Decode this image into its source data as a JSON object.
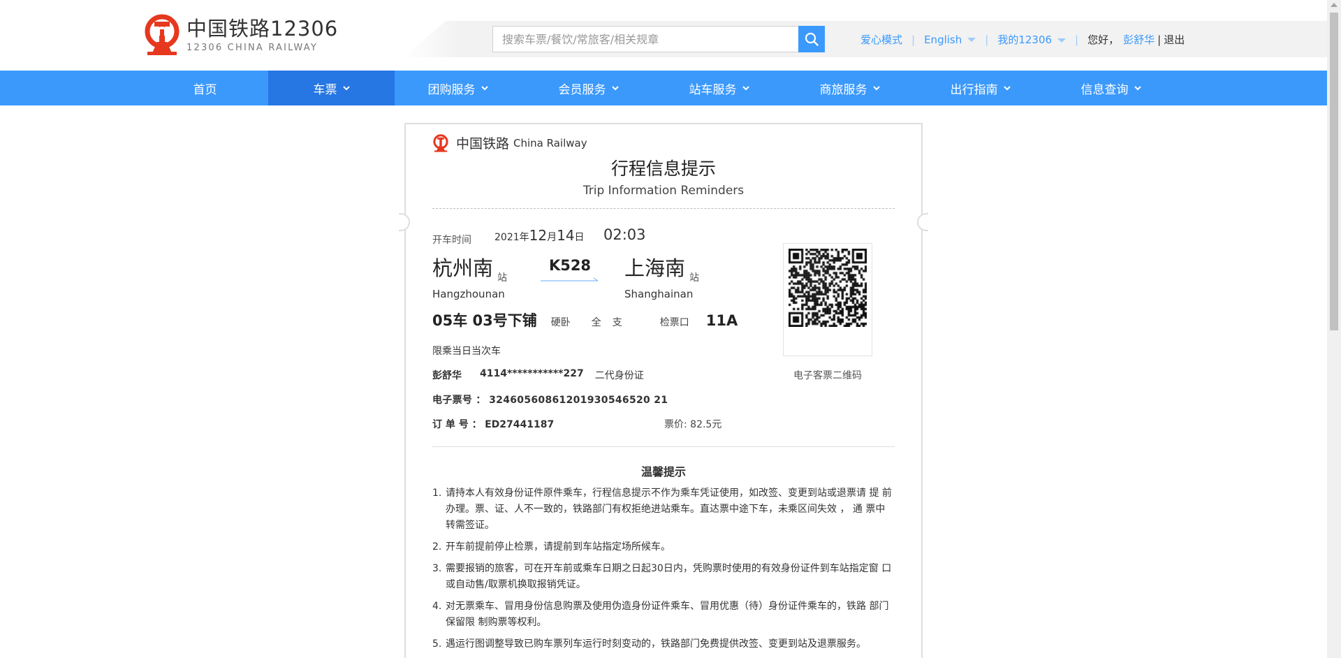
{
  "header": {
    "logo_cn": "中国铁路12306",
    "logo_en": "12306 CHINA RAILWAY",
    "search_placeholder": "搜索车票/餐饮/常旅客/相关规章",
    "links": {
      "care_mode": "爱心模式",
      "english": "English",
      "my12306": "我的12306",
      "greeting": "您好，",
      "username": "彭舒华",
      "logout": "退出"
    }
  },
  "nav": {
    "items": [
      {
        "label": "首页",
        "active": false,
        "dropdown": false
      },
      {
        "label": "车票",
        "active": true,
        "dropdown": true
      },
      {
        "label": "团购服务",
        "active": false,
        "dropdown": true
      },
      {
        "label": "会员服务",
        "active": false,
        "dropdown": true
      },
      {
        "label": "站车服务",
        "active": false,
        "dropdown": true
      },
      {
        "label": "商旅服务",
        "active": false,
        "dropdown": true
      },
      {
        "label": "出行指南",
        "active": false,
        "dropdown": true
      },
      {
        "label": "信息查询",
        "active": false,
        "dropdown": true
      }
    ]
  },
  "ticket": {
    "brand_cn": "中国铁路",
    "brand_en": "China Railway",
    "title": "行程信息提示",
    "subtitle": "Trip Information Reminders",
    "departure_label": "开车时间",
    "date": {
      "year": "2021",
      "year_unit": "年",
      "month": "12",
      "month_unit": "月",
      "day": "14",
      "day_unit": "日"
    },
    "time": "02:03",
    "from": {
      "name": "杭州南",
      "suffix": "站",
      "pinyin": "Hangzhounan"
    },
    "train_no": "K528",
    "to": {
      "name": "上海南",
      "suffix": "站",
      "pinyin": "Shanghainan"
    },
    "car_seat": "05车 03号下铺",
    "seat_type": "硬卧",
    "fare_type_1": "全",
    "fare_type_2": "支",
    "gate_label": "检票口",
    "gate": "11A",
    "limit_note": "限乘当日当次车",
    "passenger": {
      "name": "彭舒华",
      "id": "4114***********227",
      "id_type": "二代身份证"
    },
    "eticket_label": "电子票号 ：",
    "eticket_no": "32460560861201930546520 21",
    "order_label": "订 单 号 ：",
    "order_no": "ED27441187",
    "price_label": "票价:",
    "price": "82.5元",
    "qr_label": "电子客票二维码"
  },
  "tips": {
    "title": "温馨提示",
    "items": [
      {
        "num": "1.",
        "text": "请持本人有效身份证件原件乘车，行程信息提示不作为乘车凭证使用，如改签、变更到站或退票请 提 前办理。票、证、人不一致的，铁路部门有权拒绝进站乘车。直达票中途下车，未乘区间失效 ， 通 票中 转需签证。"
      },
      {
        "num": "2.",
        "text": "开车前提前停止检票，请提前到车站指定场所候车。"
      },
      {
        "num": "3.",
        "text": "需要报销的旅客，可在开车前或乘车日期之日起30日内，凭购票时使用的有效身份证件到车站指定窗 口或自动售/取票机换取报销凭证。"
      },
      {
        "num": "4.",
        "text": "对无票乘车、冒用身份信息购票及使用伪造身份证件乘车、冒用优惠（待）身份证件乘车的，铁路 部门保留限 制购票等权利。"
      },
      {
        "num": "5.",
        "text": "遇运行图调整导致已购车票列车运行时刻变动的，铁路部门免费提供改签、变更到站及退票服务。"
      }
    ]
  },
  "colors": {
    "brand_blue": "#3b99fc",
    "nav_active": "#2676e3",
    "logo_red": "#e6381f"
  },
  "icons": {
    "search": "magnifier",
    "logo": "china-railway-emblem",
    "caret": "chevron-down"
  }
}
